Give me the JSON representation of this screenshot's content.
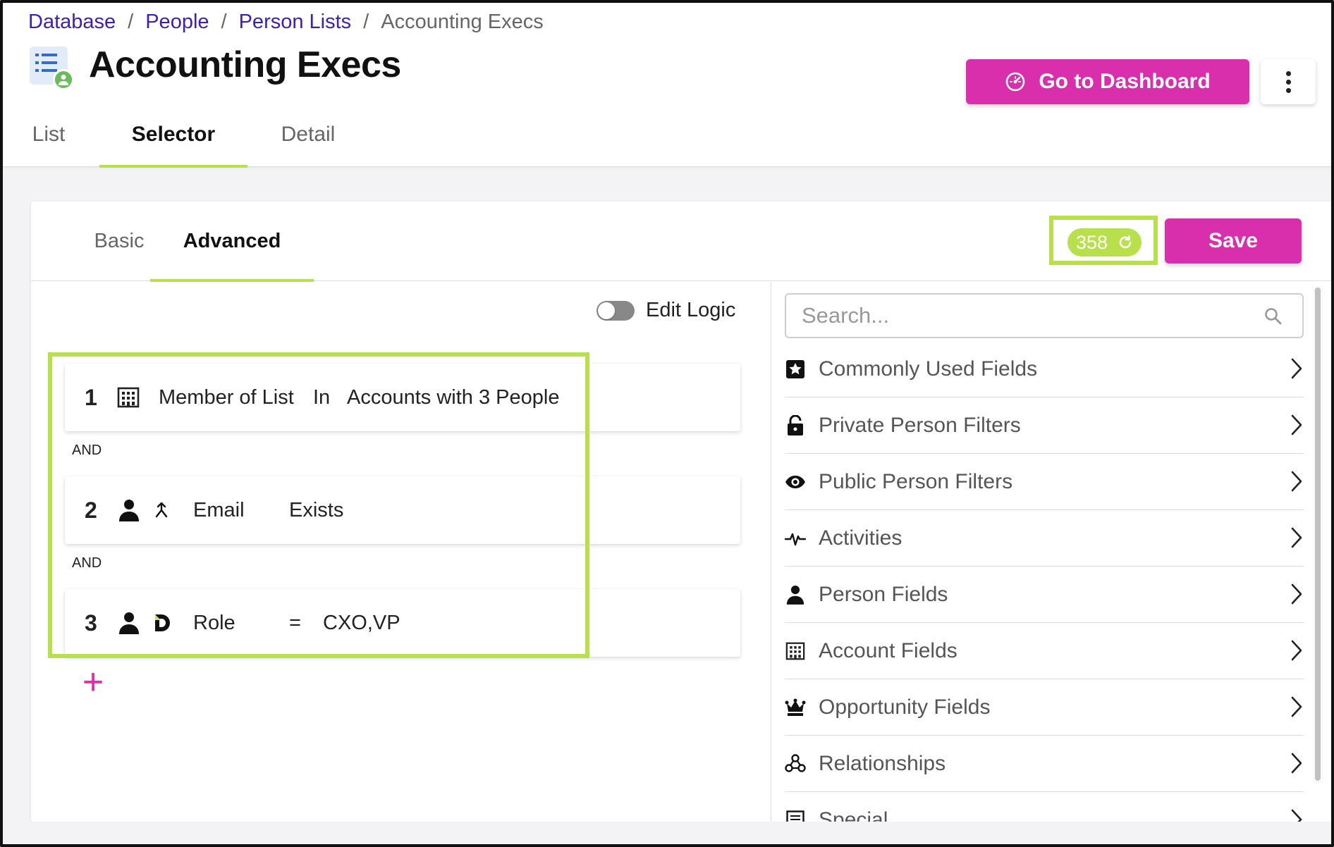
{
  "breadcrumb": {
    "items": [
      "Database",
      "People",
      "Person Lists"
    ],
    "separator": "/",
    "current": "Accounting Execs"
  },
  "page": {
    "title": "Accounting Execs",
    "dashboard_label": "Go to Dashboard"
  },
  "main_tabs": [
    {
      "label": "List",
      "active": false
    },
    {
      "label": "Selector",
      "active": true
    },
    {
      "label": "Detail",
      "active": false
    }
  ],
  "sub_tabs": [
    {
      "label": "Basic",
      "active": false
    },
    {
      "label": "Advanced",
      "active": true
    }
  ],
  "count": "358",
  "save_label": "Save",
  "edit_logic_label": "Edit Logic",
  "edit_logic_enabled": false,
  "rules": [
    {
      "num": "1",
      "icons": [
        "building-icon"
      ],
      "field": "Member of List",
      "operator": "In",
      "value": "Accounts with 3 People"
    },
    {
      "num": "2",
      "icons": [
        "person-icon",
        "merge-icon"
      ],
      "field": "Email",
      "operator": "Exists",
      "value": ""
    },
    {
      "num": "3",
      "icons": [
        "person-icon",
        "d-logo-icon"
      ],
      "field": "Role",
      "operator": "=",
      "value": "CXO,VP"
    }
  ],
  "and_label": "AND",
  "add_rule_symbol": "+",
  "search_placeholder": "Search...",
  "fields": [
    {
      "label": "Commonly Used Fields",
      "icon": "star-icon"
    },
    {
      "label": "Private Person Filters",
      "icon": "lock-icon"
    },
    {
      "label": "Public Person Filters",
      "icon": "eye-icon"
    },
    {
      "label": "Activities",
      "icon": "pulse-icon"
    },
    {
      "label": "Person Fields",
      "icon": "person-icon"
    },
    {
      "label": "Account Fields",
      "icon": "building-icon"
    },
    {
      "label": "Opportunity Fields",
      "icon": "crown-icon"
    },
    {
      "label": "Relationships",
      "icon": "network-icon"
    },
    {
      "label": "Special",
      "icon": "list-icon"
    }
  ],
  "colors": {
    "accent_pink": "#d92fac",
    "highlight_green": "#b8e04a",
    "link_purple": "#3d1fb8"
  }
}
